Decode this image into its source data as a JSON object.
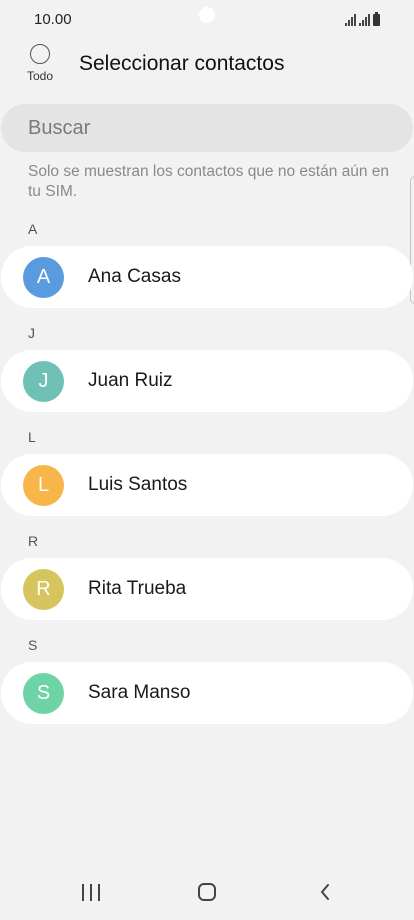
{
  "status_bar": {
    "time": "10.00"
  },
  "header": {
    "select_all_label": "Todo",
    "title": "Seleccionar contactos"
  },
  "search": {
    "placeholder": "Buscar"
  },
  "info_text": "Solo se muestran los contactos que no están aún en tu SIM.",
  "sections": [
    {
      "letter": "A",
      "contact": {
        "initial": "A",
        "name": "Ana Casas",
        "color": "#5a9be0"
      }
    },
    {
      "letter": "J",
      "contact": {
        "initial": "J",
        "name": "Juan Ruiz",
        "color": "#6fc1b5"
      }
    },
    {
      "letter": "L",
      "contact": {
        "initial": "L",
        "name": "Luis Santos",
        "color": "#f7b54a"
      }
    },
    {
      "letter": "R",
      "contact": {
        "initial": "R",
        "name": "Rita Trueba",
        "color": "#d6c55e"
      }
    },
    {
      "letter": "S",
      "contact": {
        "initial": "S",
        "name": "Sara Manso",
        "color": "#6ed3a6"
      }
    }
  ],
  "nav_bar": {
    "recents_icon": "recents-icon",
    "home_icon": "home-icon",
    "back_icon": "back-icon"
  }
}
